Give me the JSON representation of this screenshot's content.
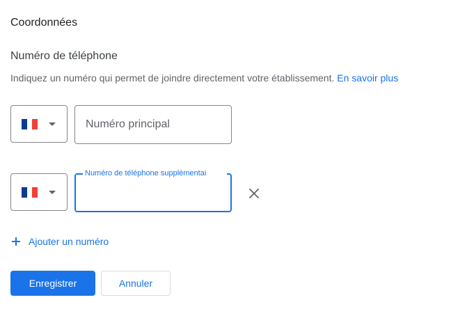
{
  "section": {
    "title": "Coordonnées"
  },
  "phone": {
    "title": "Numéro de téléphone",
    "help_text": "Indiquez un numéro qui permet de joindre directement votre établissement.",
    "help_link": "En savoir plus",
    "primary": {
      "country_flag": "france-flag",
      "placeholder": "Numéro principal",
      "value": ""
    },
    "additional": {
      "country_flag": "france-flag",
      "label": "Numéro de téléphone supplémentai",
      "value": ""
    },
    "add_label": "Ajouter un numéro"
  },
  "actions": {
    "save_label": "Enregistrer",
    "cancel_label": "Annuler"
  },
  "colors": {
    "accent": "#1a73e8",
    "flag_blue": "#0a3d91",
    "flag_red": "#ef4135"
  }
}
